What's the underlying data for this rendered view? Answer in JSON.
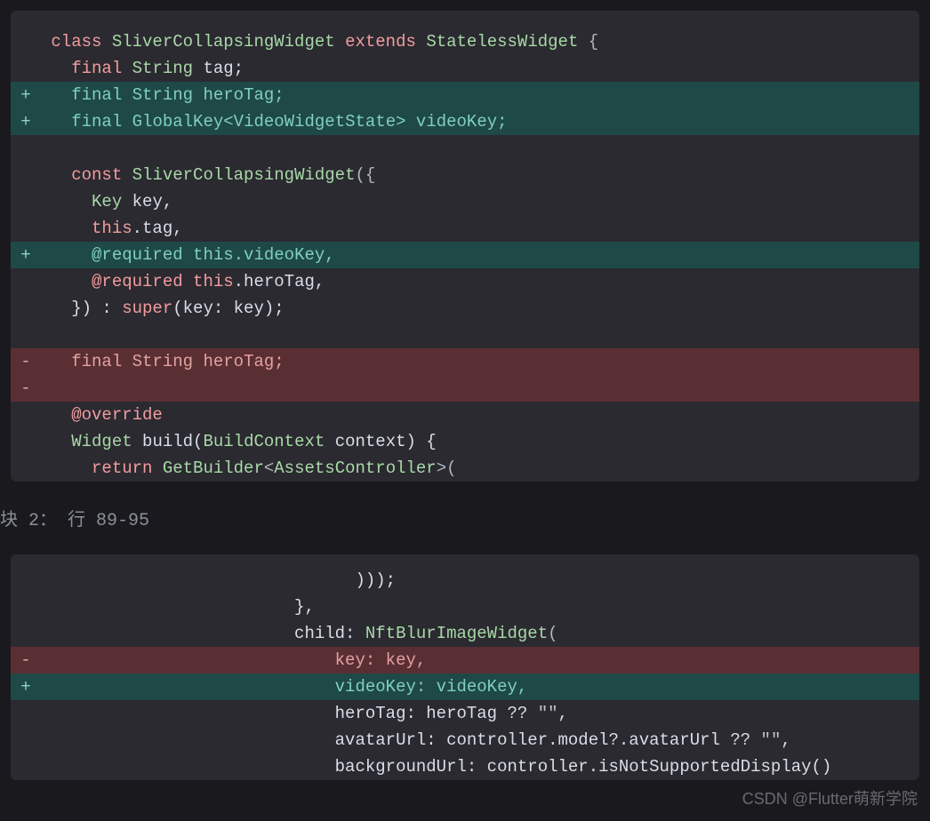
{
  "hunk1": {
    "lines": [
      {
        "marker": "",
        "bg": "ctx",
        "tokens": [
          {
            "t": " ",
            "c": "pun"
          },
          {
            "t": "class",
            "c": "kw"
          },
          {
            "t": " ",
            "c": "pun"
          },
          {
            "t": "SliverCollapsingWidget",
            "c": "type"
          },
          {
            "t": " ",
            "c": "pun"
          },
          {
            "t": "extends",
            "c": "kw"
          },
          {
            "t": " ",
            "c": "pun"
          },
          {
            "t": "StatelessWidget",
            "c": "type"
          },
          {
            "t": " {",
            "c": "pun"
          }
        ]
      },
      {
        "marker": "",
        "bg": "ctx",
        "tokens": [
          {
            "t": "   ",
            "c": "pun"
          },
          {
            "t": "final",
            "c": "kw"
          },
          {
            "t": " ",
            "c": "pun"
          },
          {
            "t": "String",
            "c": "type"
          },
          {
            "t": " tag;",
            "c": "id"
          }
        ]
      },
      {
        "marker": "+",
        "bg": "add",
        "tokens": [
          {
            "t": "   ",
            "c": "pun"
          },
          {
            "t": "final",
            "c": "add"
          },
          {
            "t": " ",
            "c": "add"
          },
          {
            "t": "String",
            "c": "add"
          },
          {
            "t": " heroTag;",
            "c": "add"
          }
        ]
      },
      {
        "marker": "+",
        "bg": "add",
        "tokens": [
          {
            "t": "   ",
            "c": "pun"
          },
          {
            "t": "final",
            "c": "add"
          },
          {
            "t": " ",
            "c": "add"
          },
          {
            "t": "GlobalKey",
            "c": "add"
          },
          {
            "t": "<",
            "c": "add"
          },
          {
            "t": "VideoWidgetState",
            "c": "add"
          },
          {
            "t": ">",
            "c": "add"
          },
          {
            "t": " videoKey;",
            "c": "add"
          }
        ]
      },
      {
        "marker": "",
        "bg": "ctx",
        "tokens": [
          {
            "t": " ",
            "c": "pun"
          }
        ]
      },
      {
        "marker": "",
        "bg": "ctx",
        "tokens": [
          {
            "t": "   ",
            "c": "pun"
          },
          {
            "t": "const",
            "c": "kw"
          },
          {
            "t": " ",
            "c": "pun"
          },
          {
            "t": "SliverCollapsingWidget",
            "c": "type"
          },
          {
            "t": "({",
            "c": "pun"
          }
        ]
      },
      {
        "marker": "",
        "bg": "ctx",
        "tokens": [
          {
            "t": "     ",
            "c": "pun"
          },
          {
            "t": "Key",
            "c": "type"
          },
          {
            "t": " key,",
            "c": "id"
          }
        ]
      },
      {
        "marker": "",
        "bg": "ctx",
        "tokens": [
          {
            "t": "     ",
            "c": "pun"
          },
          {
            "t": "this",
            "c": "kw"
          },
          {
            "t": ".tag,",
            "c": "id"
          }
        ]
      },
      {
        "marker": "+",
        "bg": "add",
        "tokens": [
          {
            "t": "     ",
            "c": "pun"
          },
          {
            "t": "@required",
            "c": "add"
          },
          {
            "t": " ",
            "c": "add"
          },
          {
            "t": "this",
            "c": "add"
          },
          {
            "t": ".videoKey,",
            "c": "add"
          }
        ]
      },
      {
        "marker": "",
        "bg": "ctx",
        "tokens": [
          {
            "t": "     ",
            "c": "pun"
          },
          {
            "t": "@required",
            "c": "ann"
          },
          {
            "t": " ",
            "c": "pun"
          },
          {
            "t": "this",
            "c": "kw"
          },
          {
            "t": ".heroTag,",
            "c": "id"
          }
        ]
      },
      {
        "marker": "",
        "bg": "ctx",
        "tokens": [
          {
            "t": "   }) : ",
            "c": "id"
          },
          {
            "t": "super",
            "c": "kw"
          },
          {
            "t": "(key: key);",
            "c": "id"
          }
        ]
      },
      {
        "marker": "",
        "bg": "ctx",
        "tokens": [
          {
            "t": " ",
            "c": "pun"
          }
        ]
      },
      {
        "marker": "-",
        "bg": "del",
        "tokens": [
          {
            "t": "   ",
            "c": "pun"
          },
          {
            "t": "final",
            "c": "del"
          },
          {
            "t": " ",
            "c": "del"
          },
          {
            "t": "String",
            "c": "del"
          },
          {
            "t": " heroTag;",
            "c": "del"
          }
        ]
      },
      {
        "marker": "-",
        "bg": "del",
        "tokens": [
          {
            "t": " ",
            "c": "pun"
          }
        ]
      },
      {
        "marker": "",
        "bg": "ctx",
        "tokens": [
          {
            "t": "   ",
            "c": "pun"
          },
          {
            "t": "@override",
            "c": "ann"
          }
        ]
      },
      {
        "marker": "",
        "bg": "ctx",
        "tokens": [
          {
            "t": "   ",
            "c": "pun"
          },
          {
            "t": "Widget",
            "c": "type"
          },
          {
            "t": " build(",
            "c": "id"
          },
          {
            "t": "BuildContext",
            "c": "type"
          },
          {
            "t": " context) {",
            "c": "id"
          }
        ]
      },
      {
        "marker": "",
        "bg": "ctx",
        "tokens": [
          {
            "t": "     ",
            "c": "pun"
          },
          {
            "t": "return",
            "c": "kw"
          },
          {
            "t": " ",
            "c": "pun"
          },
          {
            "t": "GetBuilder",
            "c": "type"
          },
          {
            "t": "<",
            "c": "pun"
          },
          {
            "t": "AssetsController",
            "c": "type"
          },
          {
            "t": ">(",
            "c": "pun"
          }
        ]
      }
    ]
  },
  "hunk_label": "块 2： 行 89-95",
  "hunk2": {
    "lines": [
      {
        "marker": "",
        "bg": "ctx",
        "tokens": [
          {
            "t": "                               )));",
            "c": "id"
          }
        ]
      },
      {
        "marker": "",
        "bg": "ctx",
        "tokens": [
          {
            "t": "                         },",
            "c": "id"
          }
        ]
      },
      {
        "marker": "",
        "bg": "ctx",
        "tokens": [
          {
            "t": "                         child: ",
            "c": "id"
          },
          {
            "t": "NftBlurImageWidget",
            "c": "type"
          },
          {
            "t": "(",
            "c": "pun"
          }
        ]
      },
      {
        "marker": "-",
        "bg": "del",
        "tokens": [
          {
            "t": "                             ",
            "c": "pun"
          },
          {
            "t": "key: key,",
            "c": "del"
          }
        ]
      },
      {
        "marker": "+",
        "bg": "add",
        "tokens": [
          {
            "t": "                             ",
            "c": "pun"
          },
          {
            "t": "videoKey: videoKey,",
            "c": "add"
          }
        ]
      },
      {
        "marker": "",
        "bg": "ctx",
        "tokens": [
          {
            "t": "                             heroTag: heroTag ?? ",
            "c": "id"
          },
          {
            "t": "\"\"",
            "c": "quote"
          },
          {
            "t": ",",
            "c": "id"
          }
        ]
      },
      {
        "marker": "",
        "bg": "ctx",
        "tokens": [
          {
            "t": "                             avatarUrl: controller.model?.avatarUrl ?? ",
            "c": "id"
          },
          {
            "t": "\"\"",
            "c": "quote"
          },
          {
            "t": ",",
            "c": "id"
          }
        ]
      },
      {
        "marker": "",
        "bg": "ctx",
        "tokens": [
          {
            "t": "                             backgroundUrl: controller.isNotSupportedDisplay()",
            "c": "id"
          }
        ]
      }
    ]
  },
  "watermark": "CSDN @Flutter萌新学院"
}
